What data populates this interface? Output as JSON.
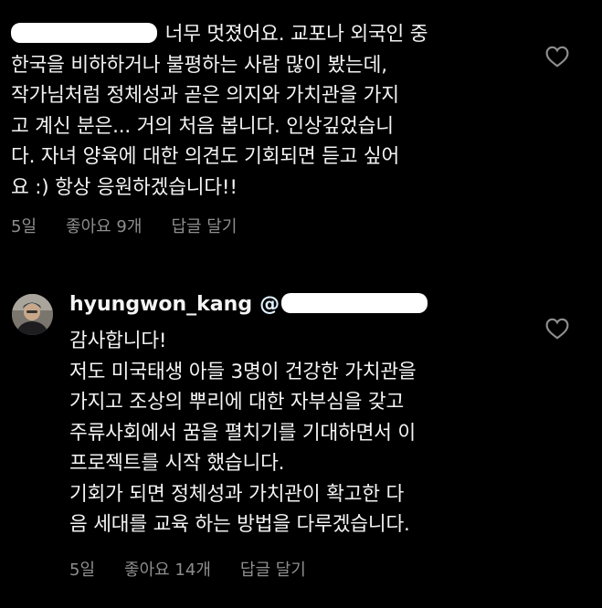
{
  "comment1": {
    "lines": [
      "너무 멋졌어요. 교포나 외국인 중",
      "한국을 비하하거나 불평하는 사람 많이 봤는데,",
      "작가님처럼 정체성과 곧은 의지와 가치관을 가지",
      "고 계신 분은... 거의 처음 봅니다. 인상깊었습니",
      "다. 자녀 양육에 대한 의견도 기회되면 듣고 싶어",
      "요 :) 항상 응원하겠습니다!!"
    ],
    "time": "5일",
    "likes": "좋아요 9개",
    "reply": "답글 달기"
  },
  "comment2": {
    "username": "hyungwon_kang",
    "mention_prefix": "@",
    "lines": [
      "감사합니다!",
      "저도 미국태생 아들 3명이 건강한 가치관을",
      "가지고 조상의 뿌리에 대한 자부심을 갖고",
      "주류사회에서 꿈을 펼치기를 기대하면서 이",
      "프로젝트를 시작 했습니다.",
      "기회가 되면 정체성과 가치관이 확고한 다",
      "음 세대를 교육 하는 방법을 다루겠습니다."
    ],
    "time": "5일",
    "likes": "좋아요 14개",
    "reply": "답글 달기"
  },
  "icons": {
    "like": "heart-outline-icon",
    "avatar": "user-avatar"
  },
  "colors": {
    "background": "#000000",
    "text": "#f4f4f4",
    "meta": "#8e8e8e",
    "mention": "#e0f1ff"
  }
}
